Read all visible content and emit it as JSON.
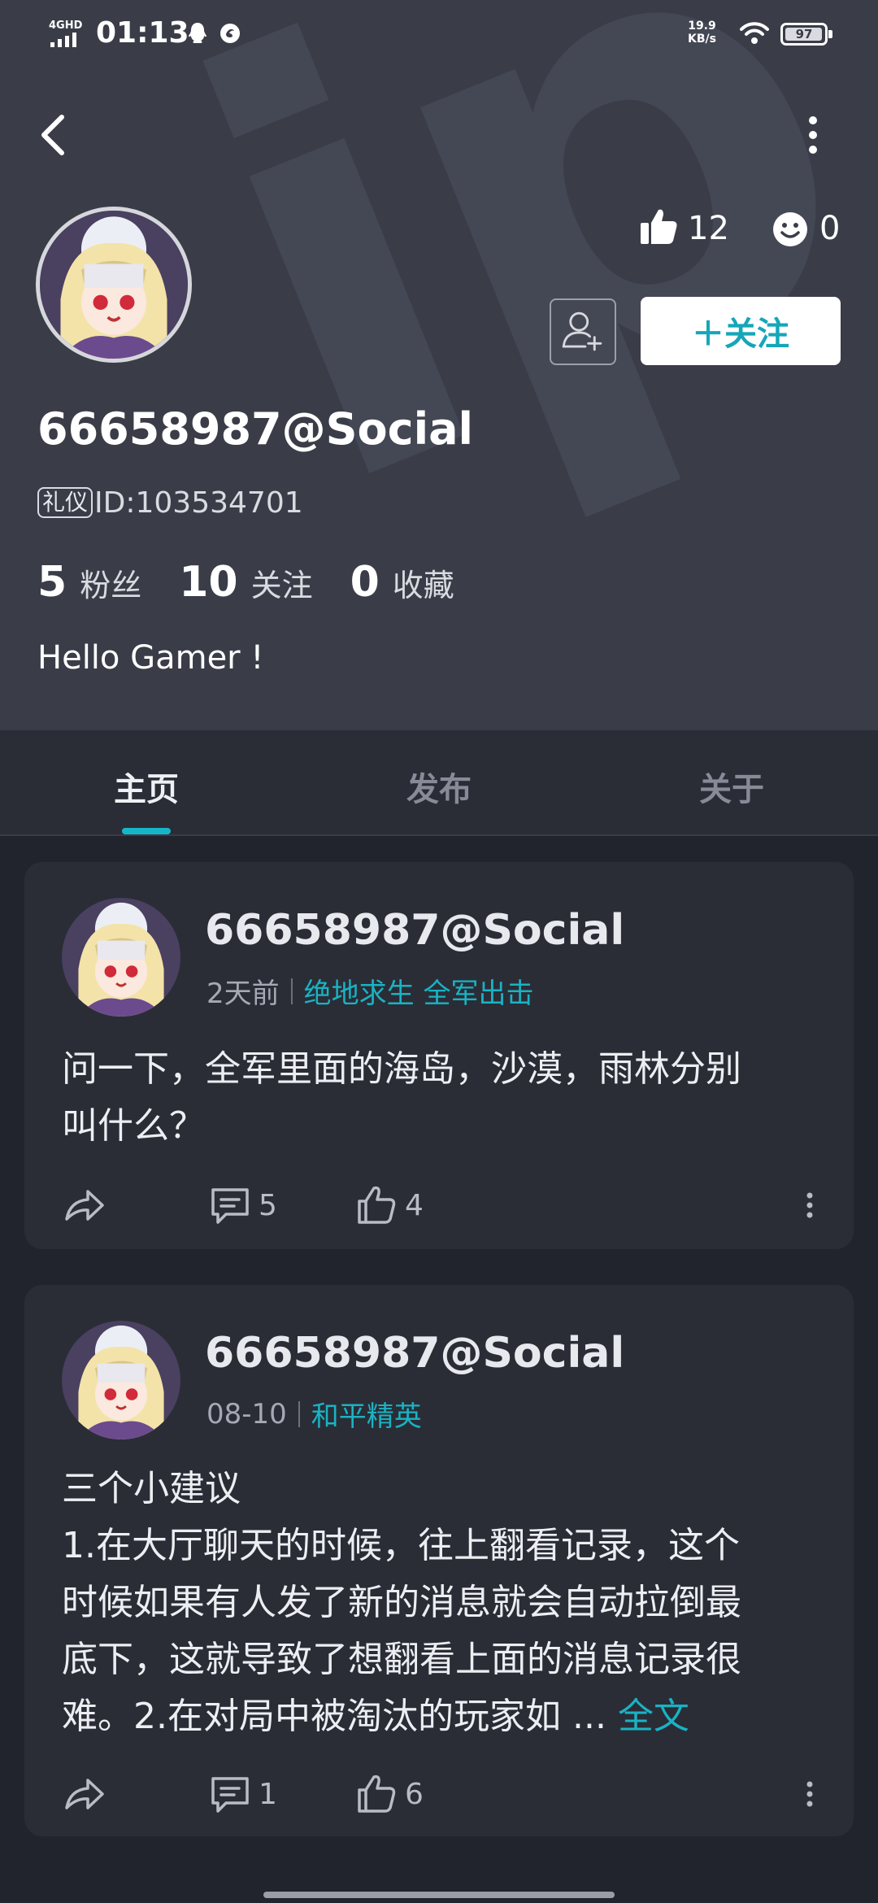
{
  "status_bar": {
    "network": "4GHD",
    "time": "01:13",
    "speed_value": "19.9",
    "speed_unit": "KB/s",
    "battery": "97",
    "battery_level": 0.97
  },
  "profile": {
    "username": "66658987@Social",
    "badge": "礼仪",
    "id_label": "ID:103534701",
    "likes": "12",
    "reactions": "0",
    "follow_label": "＋关注",
    "fans_count": "5",
    "fans_label": "粉丝",
    "following_count": "10",
    "following_label": "关注",
    "favorites_count": "0",
    "favorites_label": "收藏",
    "bio": "Hello Gamer !"
  },
  "watermark_text": "ipTap",
  "tabs": [
    {
      "label": "主页",
      "active": true
    },
    {
      "label": "发布",
      "active": false
    },
    {
      "label": "关于",
      "active": false
    }
  ],
  "posts": [
    {
      "author": "66658987@Social",
      "time": "2天前",
      "tags": [
        "绝地求生 全军出击"
      ],
      "body_lines": [
        "问一下，全军里面的海岛，沙漠，雨林分别",
        "叫什么？"
      ],
      "comments": "5",
      "likes": "4"
    },
    {
      "author": "66658987@Social",
      "time": "08-10",
      "tags": [
        "和平精英"
      ],
      "body_lines": [
        "三个小建议",
        "1.在大厅聊天的时候，往上翻看记录，这个",
        "时候如果有人发了新的消息就会自动拉倒最",
        "底下，这就导致了想翻看上面的消息记录很",
        "难。2.在对局中被淘汰的玩家如 ..."
      ],
      "more_label": "全文",
      "comments": "1",
      "likes": "6"
    }
  ],
  "colors": {
    "header_bg": "#3a3d48",
    "page_bg": "#22242d",
    "card_bg": "#2a2d36",
    "accent": "#17b6c7"
  }
}
